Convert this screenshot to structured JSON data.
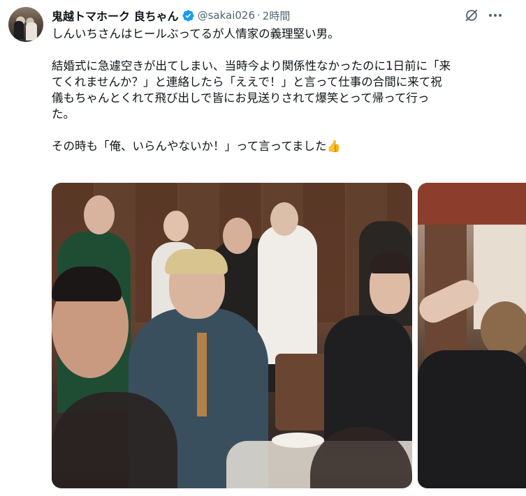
{
  "author": {
    "display_name": "鬼越トマホーク 良ちゃん",
    "handle": "@sakai026",
    "separator": "·",
    "time": "2時間",
    "verified": true
  },
  "icons": {
    "grok": "grok-icon",
    "more": "more-options-icon",
    "verified": "verified-badge-icon",
    "emoji": "thumbs-up-emoji"
  },
  "tweet": {
    "line1": "しんいちさんはヒールぶってるが人情家の義理堅い男。",
    "line2": "結婚式に急遽空きが出てしまい、当時今より関係性なかったのに1日前に「来",
    "line3": "てくれませんか？」と連絡したら「ええで！」と言って仕事の合間に来て祝",
    "line4": "儀もちゃんとくれて飛び出しで皆にお見送りされて爆笑とって帰って行っ",
    "line5": "た。",
    "line6": "その時も「俺、いらんやないか！」って言ってました",
    "emoji": "👍"
  },
  "colors": {
    "verified_blue": "#1d9bf0",
    "text_primary": "#0f1419",
    "text_secondary": "#536471"
  }
}
